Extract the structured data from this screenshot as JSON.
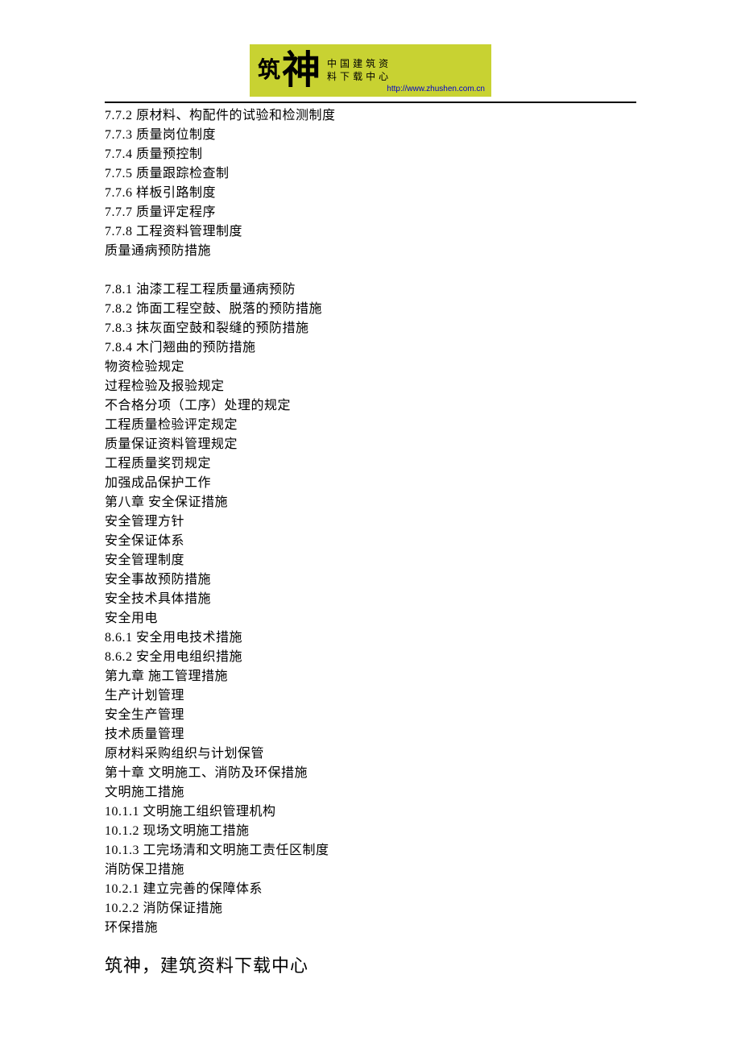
{
  "logo": {
    "zhu": "筑",
    "shen": "神",
    "tagline_cols": [
      [
        "中",
        "料"
      ],
      [
        "国",
        "下"
      ],
      [
        "建",
        "载"
      ],
      [
        "筑",
        "中"
      ],
      [
        "资",
        "心"
      ]
    ],
    "url": "http://www.zhushen.com.cn"
  },
  "lines": [
    "7.7.2 原材料、构配件的试验和检测制度",
    "7.7.3 质量岗位制度",
    "7.7.4 质量预控制",
    "7.7.5 质量跟踪检查制",
    "7.7.6 样板引路制度",
    "7.7.7 质量评定程序",
    "7.7.8 工程资料管理制度",
    "质量通病预防措施",
    "",
    "7.8.1 油漆工程工程质量通病预防",
    "7.8.2 饰面工程空鼓、脱落的预防措施",
    "7.8.3 抹灰面空鼓和裂缝的预防措施",
    "7.8.4 木门翘曲的预防措施",
    "物资检验规定",
    "过程检验及报验规定",
    "不合格分项（工序）处理的规定",
    "工程质量检验评定规定",
    "质量保证资料管理规定",
    "工程质量奖罚规定",
    "加强成品保护工作",
    "第八章  安全保证措施",
    "安全管理方针",
    "安全保证体系",
    "安全管理制度",
    "安全事故预防措施",
    "安全技术具体措施",
    "安全用电",
    "8.6.1 安全用电技术措施",
    "8.6.2 安全用电组织措施",
    "第九章  施工管理措施",
    "生产计划管理",
    "安全生产管理",
    "技术质量管理",
    "原材料采购组织与计划保管",
    "第十章  文明施工、消防及环保措施",
    "文明施工措施",
    "10.1.1  文明施工组织管理机构",
    "10.1.2  现场文明施工措施",
    "10.1.3 工完场清和文明施工责任区制度",
    "消防保卫措施",
    "10.2.1 建立完善的保障体系",
    "10.2.2 消防保证措施",
    "环保措施"
  ],
  "footer": "筑神，建筑资料下载中心"
}
